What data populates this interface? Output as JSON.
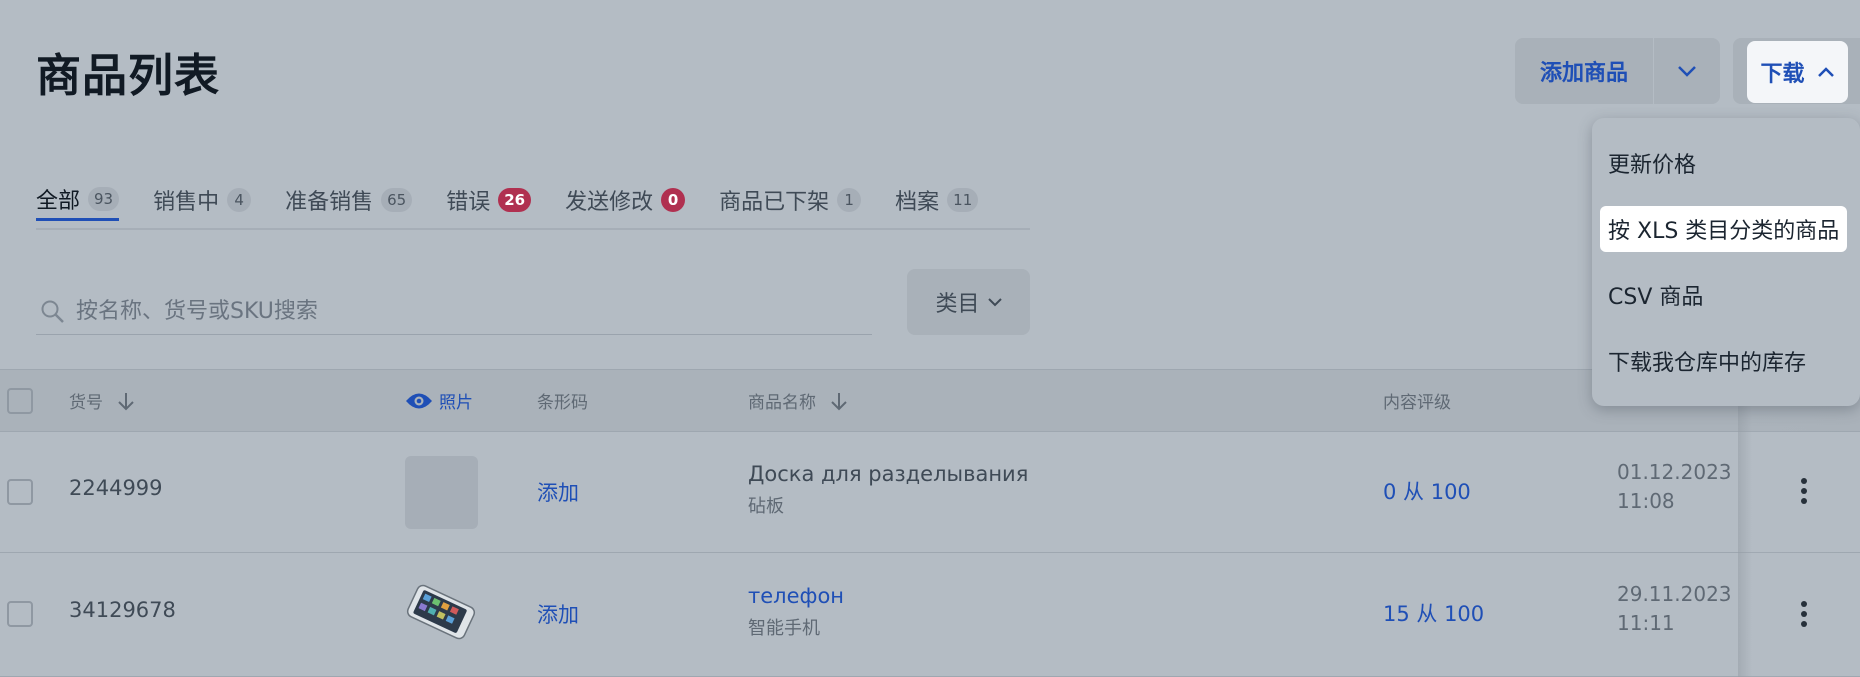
{
  "header": {
    "title": "商品列表",
    "add_product_label": "添加商品",
    "download_label": "下载"
  },
  "tabs": [
    {
      "label": "全部",
      "count": "93"
    },
    {
      "label": "销售中",
      "count": "4"
    },
    {
      "label": "准备销售",
      "count": "65"
    },
    {
      "label": "错误",
      "count": "26"
    },
    {
      "label": "发送修改",
      "count": "0"
    },
    {
      "label": "商品已下架",
      "count": "1"
    },
    {
      "label": "档案",
      "count": "11"
    }
  ],
  "search": {
    "placeholder": "按名称、货号或SKU搜索"
  },
  "category_button": "类目",
  "table": {
    "headers": {
      "sku": "货号",
      "photo": "照片",
      "barcode": "条形码",
      "name": "商品名称",
      "rating": "内容评级"
    },
    "rows": [
      {
        "sku": "2244999",
        "barcode": "添加",
        "name": "Доска для разделывания",
        "subname": "砧板",
        "rating": "0 从 100",
        "date": "01.12.2023",
        "time": "11:08"
      },
      {
        "sku": "34129678",
        "barcode": "添加",
        "name": "телефон",
        "subname": "智能手机",
        "rating": "15 从 100",
        "date": "29.11.2023",
        "time": "11:11"
      }
    ]
  },
  "download_menu": {
    "items": [
      "更新价格",
      "按 XLS 类目分类的商品",
      "CSV 商品",
      "下载我仓库中的库存"
    ],
    "highlighted_index": 1
  },
  "colors": {
    "accent": "#1f4fb6",
    "error_badge": "#b03050"
  }
}
